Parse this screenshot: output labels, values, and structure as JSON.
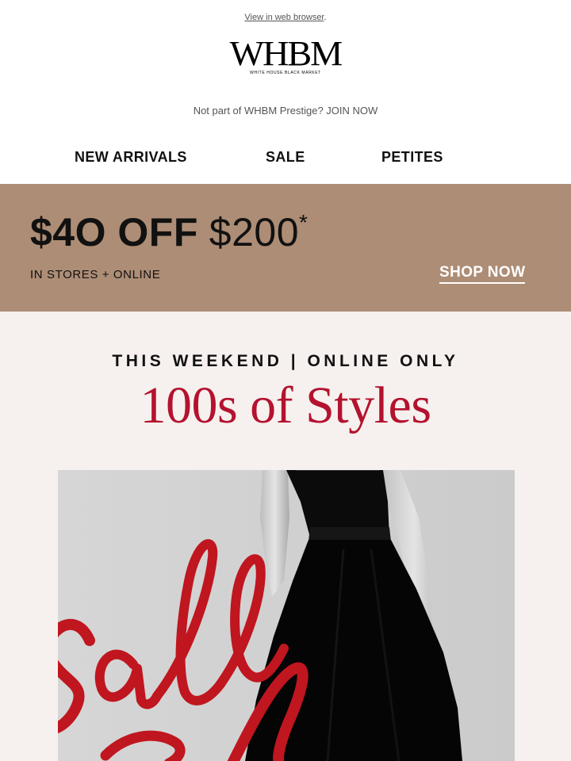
{
  "header": {
    "browser_link": "View in web browser",
    "browser_link_suffix": ".",
    "logo": "WHBM",
    "logo_sub": "WHITE HOUSE BLACK MARKET",
    "prestige_text": "Not part of WHBM Prestige? JOIN NOW"
  },
  "nav": {
    "items": [
      {
        "label": "NEW ARRIVALS"
      },
      {
        "label": "SALE"
      },
      {
        "label": "PETITES"
      }
    ]
  },
  "promo": {
    "offer_bold": "$4O OFF",
    "offer_light": "$200",
    "offer_mark": "*",
    "subtitle": "IN STORES + ONLINE",
    "cta": "SHOP NOW"
  },
  "hero": {
    "kicker": "THIS WEEKEND | ONLINE ONLY",
    "headline": "100s of Styles"
  },
  "colors": {
    "promo_bg": "#ad8d75",
    "hero_bg": "#f6f1ee",
    "headline_red": "#b4122f",
    "script_red": "#c0161f"
  },
  "icons": {
    "image": "woman-in-black-dress-photo",
    "script": "sale-script-lettering"
  }
}
